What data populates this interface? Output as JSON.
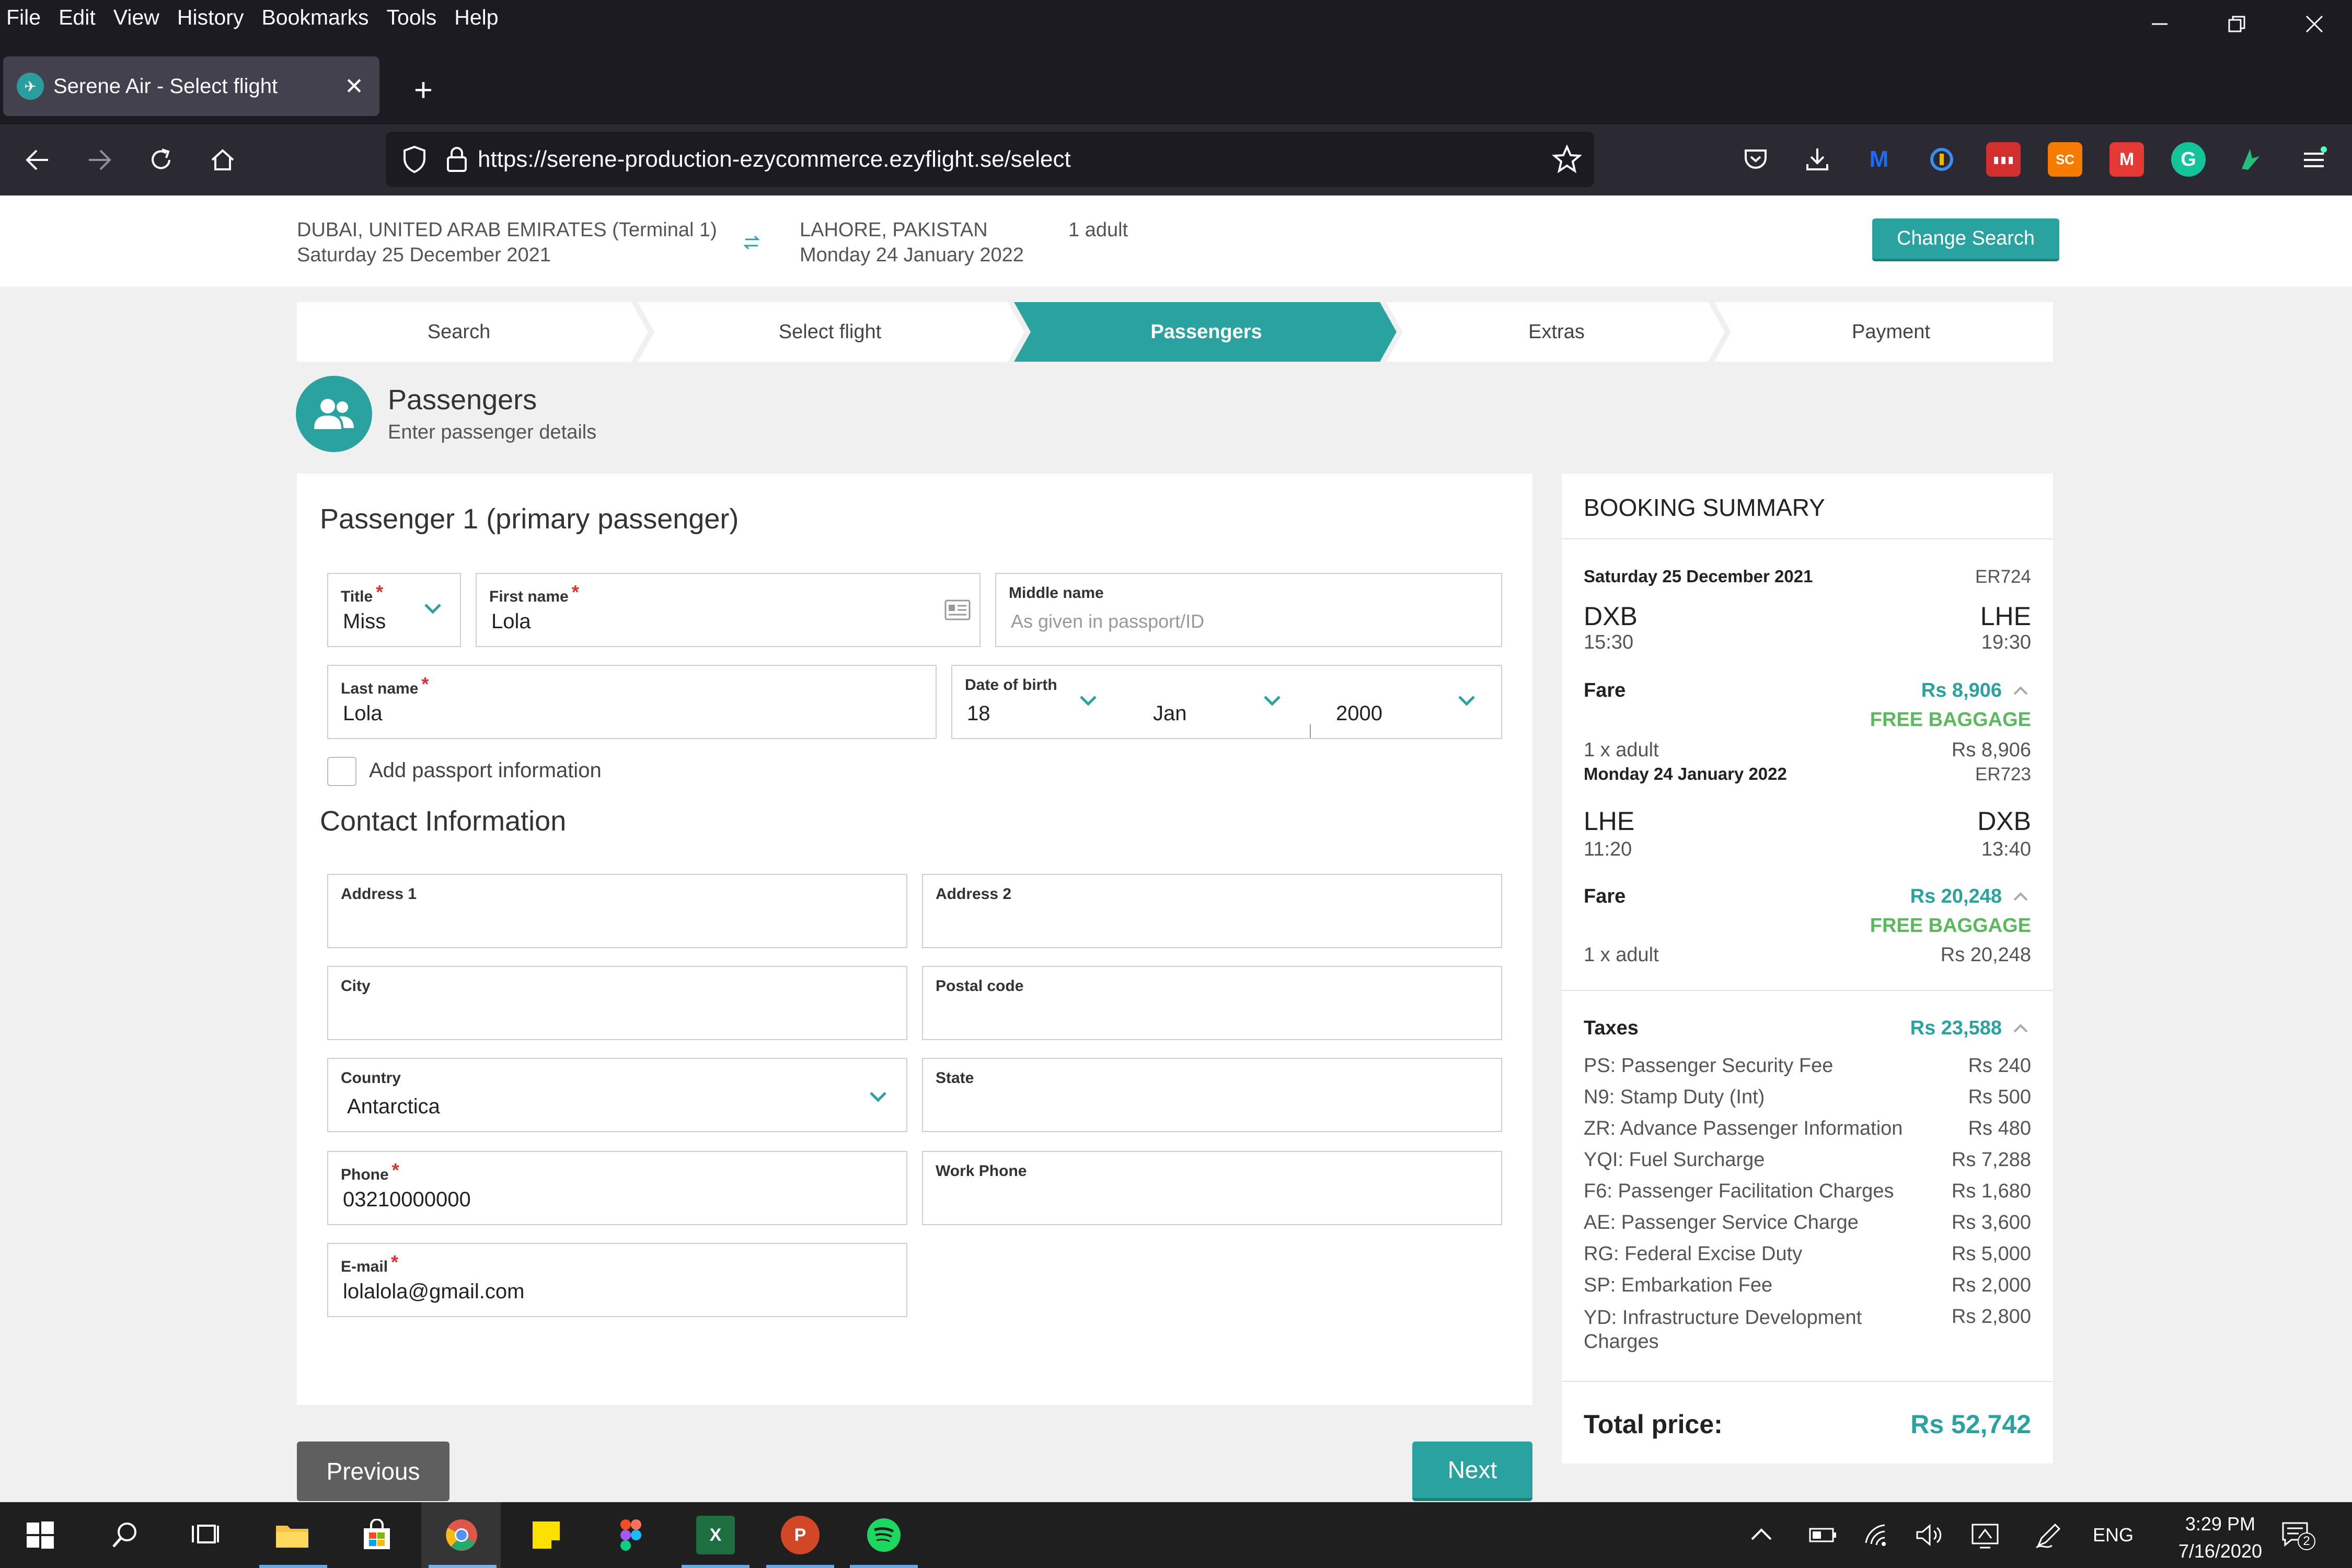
{
  "browser": {
    "menu": [
      "File",
      "Edit",
      "View",
      "History",
      "Bookmarks",
      "Tools",
      "Help"
    ],
    "tab_title": "Serene Air - Select flight",
    "url": "https://serene-production-ezycommerce.ezyflight.se/select"
  },
  "extensions": [
    {
      "name": "pocket-icon",
      "label": "",
      "color": "#2b2a33"
    },
    {
      "name": "download-icon",
      "label": "",
      "color": "#2b2a33"
    },
    {
      "name": "extension-m-icon",
      "label": "M",
      "color": "#1d4fd8"
    },
    {
      "name": "extension-shield-icon",
      "label": "",
      "color": "#2b2a33"
    },
    {
      "name": "extension-red-icon",
      "label": "",
      "color": "#d32f2f"
    },
    {
      "name": "extension-sc-icon",
      "label": "SC",
      "color": "#f57c00"
    },
    {
      "name": "extension-mm-icon",
      "label": "M",
      "color": "#e53935"
    },
    {
      "name": "grammarly-icon",
      "label": "G",
      "color": "#15c39a"
    },
    {
      "name": "extension-green-icon",
      "label": "",
      "color": "#2b2a33"
    }
  ],
  "header": {
    "origin": "DUBAI, UNITED ARAB EMIRATES (Terminal 1)",
    "origin_date": "Saturday 25 December 2021",
    "destination": "LAHORE, PAKISTAN",
    "destination_date": "Monday 24 January 2022",
    "passengers": "1 adult",
    "change_search": "Change Search"
  },
  "steps": [
    {
      "label": "Search",
      "active": false
    },
    {
      "label": "Select flight",
      "active": false
    },
    {
      "label": "Passengers",
      "active": true
    },
    {
      "label": "Extras",
      "active": false
    },
    {
      "label": "Payment",
      "active": false
    }
  ],
  "page": {
    "title": "Passengers",
    "subtitle": "Enter passenger details"
  },
  "form": {
    "passenger_heading": "Passenger 1 (primary passenger)",
    "title_label": "Title",
    "title_value": "Miss",
    "first_name_label": "First name",
    "first_name_value": "Lola",
    "middle_name_label": "Middle name",
    "middle_name_placeholder": "As given in passport/ID",
    "last_name_label": "Last name",
    "last_name_value": "Lola",
    "dob_label": "Date of birth",
    "dob_day": "18",
    "dob_month": "Jan",
    "dob_year": "2000",
    "passport_label": "Add passport information",
    "contact_heading": "Contact Information",
    "address1_label": "Address 1",
    "address2_label": "Address 2",
    "city_label": "City",
    "postal_label": "Postal code",
    "country_label": "Country",
    "country_value": "Antarctica",
    "state_label": "State",
    "phone_label": "Phone",
    "phone_value": "03210000000",
    "work_phone_label": "Work Phone",
    "email_label": "E-mail",
    "email_value": "lolalola@gmail.com"
  },
  "buttons": {
    "previous": "Previous",
    "next": "Next"
  },
  "summary": {
    "heading": "BOOKING SUMMARY",
    "out_date": "Saturday 25 December 2021",
    "out_flight": "ER724",
    "out_from": "DXB",
    "out_from_time": "15:30",
    "out_to": "LHE",
    "out_to_time": "19:30",
    "fare_label": "Fare",
    "out_fare": "Rs 8,906",
    "free_baggage": "FREE BAGGAGE",
    "out_pax": "1 x adult",
    "out_pax_price": "Rs 8,906",
    "ret_date": "Monday 24 January 2022",
    "ret_flight": "ER723",
    "ret_from": "LHE",
    "ret_from_time": "11:20",
    "ret_to": "DXB",
    "ret_to_time": "13:40",
    "ret_fare": "Rs 20,248",
    "ret_pax": "1 x adult",
    "ret_pax_price": "Rs 20,248",
    "taxes_label": "Taxes",
    "taxes_total": "Rs 23,588",
    "taxes": [
      {
        "name": "PS: Passenger Security Fee",
        "amount": "Rs 240"
      },
      {
        "name": "N9: Stamp Duty (Int)",
        "amount": "Rs 500"
      },
      {
        "name": "ZR: Advance Passenger Information",
        "amount": "Rs 480"
      },
      {
        "name": "YQI: Fuel Surcharge",
        "amount": "Rs 7,288"
      },
      {
        "name": "F6: Passenger Facilitation Charges",
        "amount": "Rs 1,680"
      },
      {
        "name": "AE: Passenger Service Charge",
        "amount": "Rs 3,600"
      },
      {
        "name": "RG: Federal Excise Duty",
        "amount": "Rs 5,000"
      },
      {
        "name": "SP: Embarkation Fee",
        "amount": "Rs 2,000"
      },
      {
        "name": "YD: Infrastructure Development Charges",
        "amount": "Rs 2,800"
      }
    ],
    "total_label": "Total price:",
    "total_value": "Rs 52,742"
  },
  "taskbar": {
    "language": "ENG",
    "time": "3:29 PM",
    "date": "7/16/2020",
    "notifications": "2"
  },
  "colors": {
    "accent": "#2aa3a0",
    "baggage": "#5cb85c",
    "required": "#d63333"
  }
}
